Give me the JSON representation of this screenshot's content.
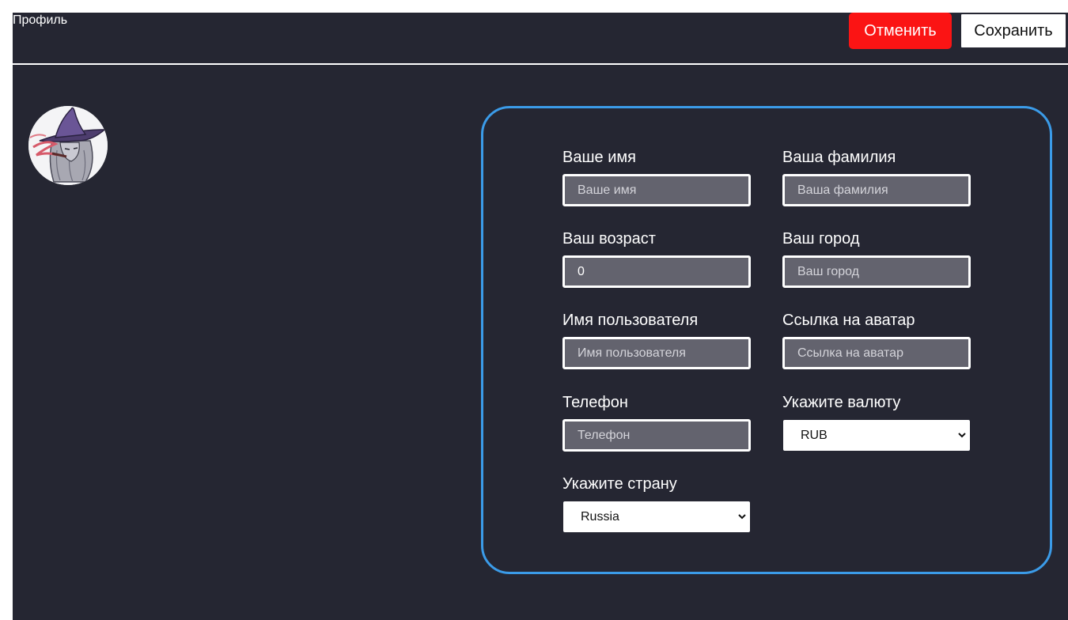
{
  "header": {
    "title": "Профиль",
    "cancel_label": "Отменить",
    "save_label": "Сохранить"
  },
  "avatar": {
    "icon": "user-avatar-witch"
  },
  "form": {
    "first_name": {
      "label": "Ваше имя",
      "value": "",
      "placeholder": "Ваше имя"
    },
    "last_name": {
      "label": "Ваша фамилия",
      "value": "",
      "placeholder": "Ваша фамилия"
    },
    "age": {
      "label": "Ваш возраст",
      "value": "0",
      "placeholder": ""
    },
    "city": {
      "label": "Ваш город",
      "value": "",
      "placeholder": "Ваш город"
    },
    "username": {
      "label": "Имя пользователя",
      "value": "",
      "placeholder": "Имя пользователя"
    },
    "avatar_url": {
      "label": "Ссылка на аватар",
      "value": "",
      "placeholder": "Ссылка на аватар"
    },
    "phone": {
      "label": "Телефон",
      "value": "",
      "placeholder": "Телефон"
    },
    "currency": {
      "label": "Укажите валюту",
      "selected": "RUB"
    },
    "country": {
      "label": "Укажите страну",
      "selected": "Russia"
    }
  },
  "colors": {
    "background": "#252632",
    "cancel_button": "#fb1414",
    "card_border": "#3b9be8",
    "input_background": "#63636e"
  }
}
